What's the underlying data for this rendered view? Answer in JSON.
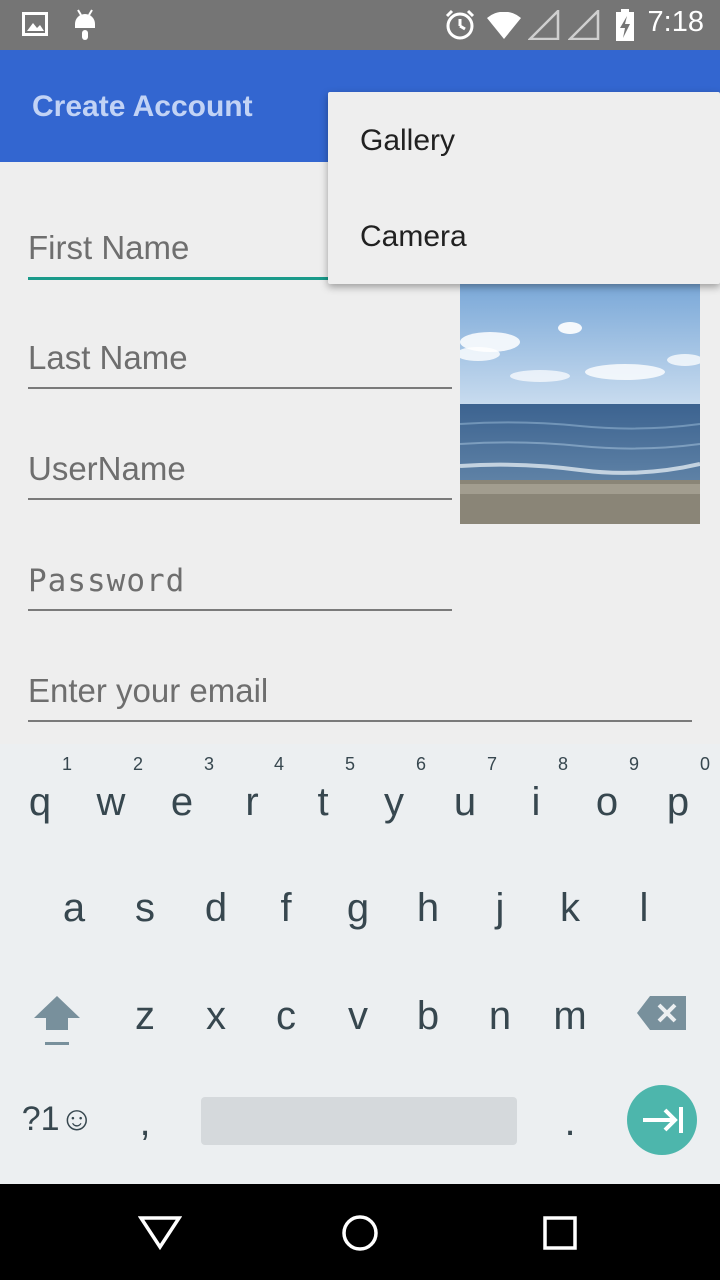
{
  "status_bar": {
    "time": "7:18",
    "icons_left": [
      "image-icon",
      "android-icon"
    ],
    "icons_right": [
      "alarm-icon",
      "wifi-icon",
      "signal-icon",
      "signal-icon-2",
      "battery-charging-icon"
    ]
  },
  "app_bar": {
    "title": "Create Account",
    "color": "#3366d0"
  },
  "form": {
    "first_name": "First Name",
    "last_name": "Last Name",
    "username": "UserName",
    "password": "Password",
    "email": "Enter your email"
  },
  "popup_menu": {
    "items": [
      "Gallery",
      "Camera"
    ]
  },
  "keyboard": {
    "row1": [
      "q",
      "w",
      "e",
      "r",
      "t",
      "y",
      "u",
      "i",
      "o",
      "p"
    ],
    "row1_hints": [
      "1",
      "2",
      "3",
      "4",
      "5",
      "6",
      "7",
      "8",
      "9",
      "0"
    ],
    "row2": [
      "a",
      "s",
      "d",
      "f",
      "g",
      "h",
      "j",
      "k",
      "l"
    ],
    "row3": [
      "z",
      "x",
      "c",
      "v",
      "b",
      "n",
      "m"
    ],
    "symbols_key": "?1☺",
    "comma": ",",
    "period": ".",
    "accent": "#4db6ac"
  },
  "nav_bar": {
    "icons": [
      "back-icon",
      "home-icon",
      "recents-icon"
    ]
  }
}
